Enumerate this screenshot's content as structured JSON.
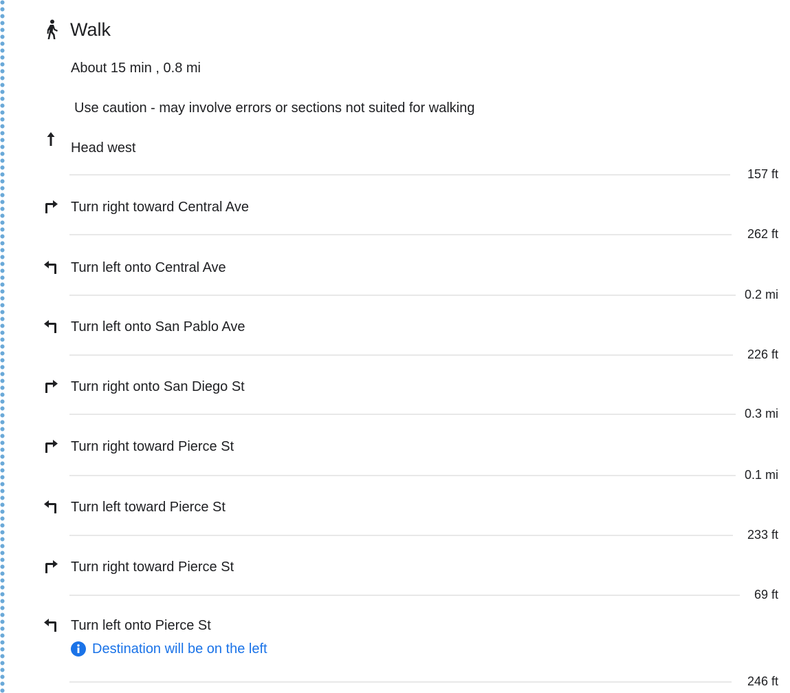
{
  "walk": {
    "title": "Walk",
    "summary": "About 15 min , 0.8 mi",
    "caution": "Use caution - may involve errors or sections not suited for walking"
  },
  "steps": [
    {
      "text": "Head west",
      "distance": "157 ft",
      "icon": "arrow-up-icon"
    },
    {
      "text": "Turn right toward Central Ave",
      "distance": "262 ft",
      "icon": "turn-right-icon"
    },
    {
      "text": "Turn left onto Central Ave",
      "distance": "0.2 mi",
      "icon": "turn-left-icon"
    },
    {
      "text": "Turn left onto San Pablo Ave",
      "distance": "226 ft",
      "icon": "turn-left-icon"
    },
    {
      "text": "Turn right onto San Diego St",
      "distance": "0.3 mi",
      "icon": "turn-right-icon"
    },
    {
      "text": "Turn right toward Pierce St",
      "distance": "0.1 mi",
      "icon": "turn-right-icon"
    },
    {
      "text": "Turn left toward Pierce St",
      "distance": "233 ft",
      "icon": "turn-left-icon"
    },
    {
      "text": "Turn right toward Pierce St",
      "distance": "69 ft",
      "icon": "turn-right-icon"
    },
    {
      "text": "Turn left onto Pierce St",
      "distance": "246 ft",
      "icon": "turn-left-icon",
      "note": "Destination will be on the left"
    }
  ],
  "colors": {
    "route_dots": "#6aa9d8",
    "note_link": "#1a73e8",
    "info_icon": "#1a73e8",
    "divider": "#e8e8e8",
    "text": "#202124"
  }
}
